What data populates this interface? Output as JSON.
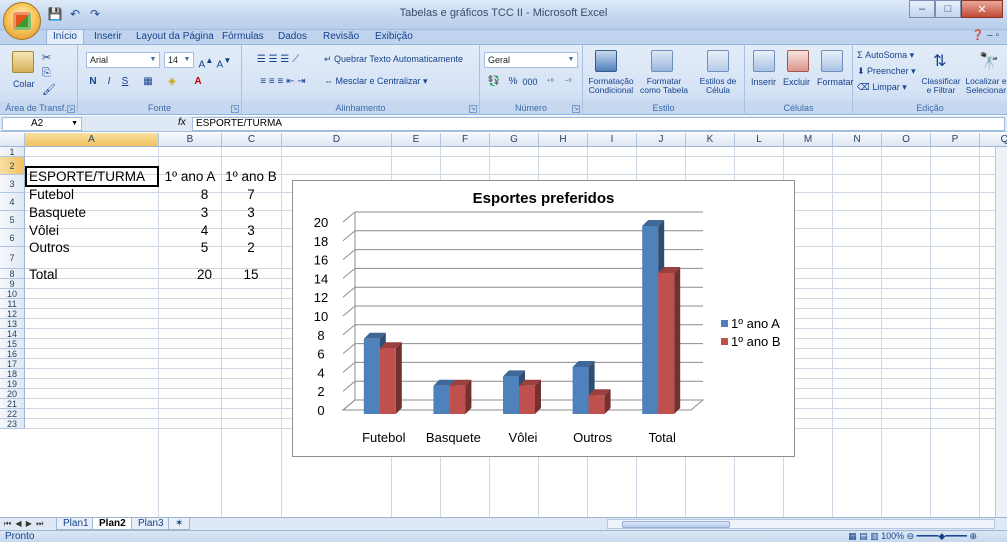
{
  "window": {
    "title": "Tabelas e gráficos TCC II - Microsoft Excel",
    "controls": {
      "minimize": "–",
      "maximize": "□",
      "close": "✕"
    }
  },
  "qat": {
    "save": "💾",
    "undo": "↶",
    "redo": "↷"
  },
  "tabs": [
    "Início",
    "Inserir",
    "Layout da Página",
    "Fórmulas",
    "Dados",
    "Revisão",
    "Exibição"
  ],
  "ribbon": {
    "clipboard": {
      "label": "Área de Transf...",
      "paste": "Colar"
    },
    "font": {
      "label": "Fonte",
      "name": "Arial",
      "size": "14",
      "bold": "N",
      "italic": "I",
      "underline": "S"
    },
    "alignment": {
      "label": "Alinhamento",
      "wrap": "Quebrar Texto Automaticamente",
      "merge": "Mesclar e Centralizar"
    },
    "number": {
      "label": "Número",
      "format": "Geral",
      "percent": "%",
      "thousands": "000"
    },
    "styles": {
      "label": "Estilo",
      "conditional": "Formatação Condicional",
      "table": "Formatar como Tabela",
      "cell": "Estilos de Célula"
    },
    "cells": {
      "label": "Células",
      "insert": "Inserir",
      "delete": "Excluir",
      "format": "Formatar"
    },
    "editing": {
      "label": "Edição",
      "autosum": "AutoSoma",
      "fill": "Preencher",
      "clear": "Limpar",
      "sort": "Classificar e Filtrar",
      "find": "Localizar e Selecionar"
    }
  },
  "formula_bar": {
    "name_box": "A2",
    "fx": "fx",
    "value": "ESPORTE/TURMA"
  },
  "columns": [
    "A",
    "B",
    "C",
    "D",
    "E",
    "F",
    "G",
    "H",
    "I",
    "J",
    "K",
    "L",
    "M",
    "N",
    "O",
    "P",
    "Q"
  ],
  "rows": [
    "1",
    "2",
    "3",
    "4",
    "5",
    "6",
    "7",
    "8",
    "9",
    "10",
    "11",
    "12",
    "13",
    "14",
    "15",
    "16",
    "17",
    "18",
    "19",
    "20",
    "21",
    "22",
    "23"
  ],
  "table": {
    "header": [
      "ESPORTE/TURMA",
      "1º ano A",
      "1º ano B"
    ],
    "rows": [
      [
        "Futebol",
        "8",
        "7"
      ],
      [
        "Basquete",
        "3",
        "3"
      ],
      [
        "Vôlei",
        "4",
        "3"
      ],
      [
        "Outros",
        "5",
        "2"
      ],
      [
        "Total",
        "20",
        "15"
      ]
    ]
  },
  "chart_data": {
    "type": "bar",
    "title": "Esportes preferidos",
    "categories": [
      "Futebol",
      "Basquete",
      "Vôlei",
      "Outros",
      "Total"
    ],
    "series": [
      {
        "name": "1º ano A",
        "values": [
          8,
          3,
          4,
          5,
          20
        ],
        "color": "#4f81bd"
      },
      {
        "name": "1º ano B",
        "values": [
          7,
          3,
          3,
          2,
          15
        ],
        "color": "#c0504d"
      }
    ],
    "y_ticks": [
      "0",
      "2",
      "4",
      "6",
      "8",
      "10",
      "12",
      "14",
      "16",
      "18",
      "20"
    ],
    "ylim": [
      0,
      20
    ],
    "grid": true,
    "legend": "right",
    "style": "3d-clustered-column"
  },
  "sheets": [
    "Plan1",
    "Plan2",
    "Plan3"
  ],
  "active_sheet": "Plan2",
  "status": {
    "text": "Pronto",
    "zoom": "100%"
  }
}
